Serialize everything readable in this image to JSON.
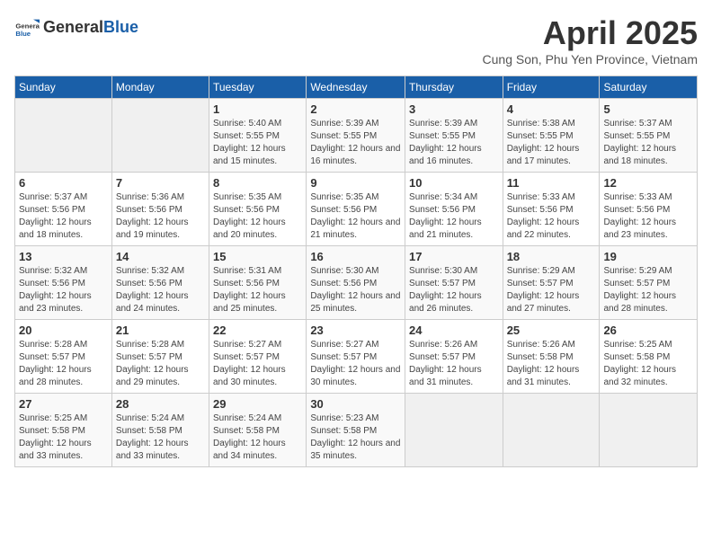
{
  "logo": {
    "general": "General",
    "blue": "Blue"
  },
  "header": {
    "month": "April 2025",
    "location": "Cung Son, Phu Yen Province, Vietnam"
  },
  "weekdays": [
    "Sunday",
    "Monday",
    "Tuesday",
    "Wednesday",
    "Thursday",
    "Friday",
    "Saturday"
  ],
  "weeks": [
    [
      {
        "day": "",
        "info": ""
      },
      {
        "day": "",
        "info": ""
      },
      {
        "day": "1",
        "info": "Sunrise: 5:40 AM\nSunset: 5:55 PM\nDaylight: 12 hours and 15 minutes."
      },
      {
        "day": "2",
        "info": "Sunrise: 5:39 AM\nSunset: 5:55 PM\nDaylight: 12 hours and 16 minutes."
      },
      {
        "day": "3",
        "info": "Sunrise: 5:39 AM\nSunset: 5:55 PM\nDaylight: 12 hours and 16 minutes."
      },
      {
        "day": "4",
        "info": "Sunrise: 5:38 AM\nSunset: 5:55 PM\nDaylight: 12 hours and 17 minutes."
      },
      {
        "day": "5",
        "info": "Sunrise: 5:37 AM\nSunset: 5:55 PM\nDaylight: 12 hours and 18 minutes."
      }
    ],
    [
      {
        "day": "6",
        "info": "Sunrise: 5:37 AM\nSunset: 5:56 PM\nDaylight: 12 hours and 18 minutes."
      },
      {
        "day": "7",
        "info": "Sunrise: 5:36 AM\nSunset: 5:56 PM\nDaylight: 12 hours and 19 minutes."
      },
      {
        "day": "8",
        "info": "Sunrise: 5:35 AM\nSunset: 5:56 PM\nDaylight: 12 hours and 20 minutes."
      },
      {
        "day": "9",
        "info": "Sunrise: 5:35 AM\nSunset: 5:56 PM\nDaylight: 12 hours and 21 minutes."
      },
      {
        "day": "10",
        "info": "Sunrise: 5:34 AM\nSunset: 5:56 PM\nDaylight: 12 hours and 21 minutes."
      },
      {
        "day": "11",
        "info": "Sunrise: 5:33 AM\nSunset: 5:56 PM\nDaylight: 12 hours and 22 minutes."
      },
      {
        "day": "12",
        "info": "Sunrise: 5:33 AM\nSunset: 5:56 PM\nDaylight: 12 hours and 23 minutes."
      }
    ],
    [
      {
        "day": "13",
        "info": "Sunrise: 5:32 AM\nSunset: 5:56 PM\nDaylight: 12 hours and 23 minutes."
      },
      {
        "day": "14",
        "info": "Sunrise: 5:32 AM\nSunset: 5:56 PM\nDaylight: 12 hours and 24 minutes."
      },
      {
        "day": "15",
        "info": "Sunrise: 5:31 AM\nSunset: 5:56 PM\nDaylight: 12 hours and 25 minutes."
      },
      {
        "day": "16",
        "info": "Sunrise: 5:30 AM\nSunset: 5:56 PM\nDaylight: 12 hours and 25 minutes."
      },
      {
        "day": "17",
        "info": "Sunrise: 5:30 AM\nSunset: 5:57 PM\nDaylight: 12 hours and 26 minutes."
      },
      {
        "day": "18",
        "info": "Sunrise: 5:29 AM\nSunset: 5:57 PM\nDaylight: 12 hours and 27 minutes."
      },
      {
        "day": "19",
        "info": "Sunrise: 5:29 AM\nSunset: 5:57 PM\nDaylight: 12 hours and 28 minutes."
      }
    ],
    [
      {
        "day": "20",
        "info": "Sunrise: 5:28 AM\nSunset: 5:57 PM\nDaylight: 12 hours and 28 minutes."
      },
      {
        "day": "21",
        "info": "Sunrise: 5:28 AM\nSunset: 5:57 PM\nDaylight: 12 hours and 29 minutes."
      },
      {
        "day": "22",
        "info": "Sunrise: 5:27 AM\nSunset: 5:57 PM\nDaylight: 12 hours and 30 minutes."
      },
      {
        "day": "23",
        "info": "Sunrise: 5:27 AM\nSunset: 5:57 PM\nDaylight: 12 hours and 30 minutes."
      },
      {
        "day": "24",
        "info": "Sunrise: 5:26 AM\nSunset: 5:57 PM\nDaylight: 12 hours and 31 minutes."
      },
      {
        "day": "25",
        "info": "Sunrise: 5:26 AM\nSunset: 5:58 PM\nDaylight: 12 hours and 31 minutes."
      },
      {
        "day": "26",
        "info": "Sunrise: 5:25 AM\nSunset: 5:58 PM\nDaylight: 12 hours and 32 minutes."
      }
    ],
    [
      {
        "day": "27",
        "info": "Sunrise: 5:25 AM\nSunset: 5:58 PM\nDaylight: 12 hours and 33 minutes."
      },
      {
        "day": "28",
        "info": "Sunrise: 5:24 AM\nSunset: 5:58 PM\nDaylight: 12 hours and 33 minutes."
      },
      {
        "day": "29",
        "info": "Sunrise: 5:24 AM\nSunset: 5:58 PM\nDaylight: 12 hours and 34 minutes."
      },
      {
        "day": "30",
        "info": "Sunrise: 5:23 AM\nSunset: 5:58 PM\nDaylight: 12 hours and 35 minutes."
      },
      {
        "day": "",
        "info": ""
      },
      {
        "day": "",
        "info": ""
      },
      {
        "day": "",
        "info": ""
      }
    ]
  ]
}
